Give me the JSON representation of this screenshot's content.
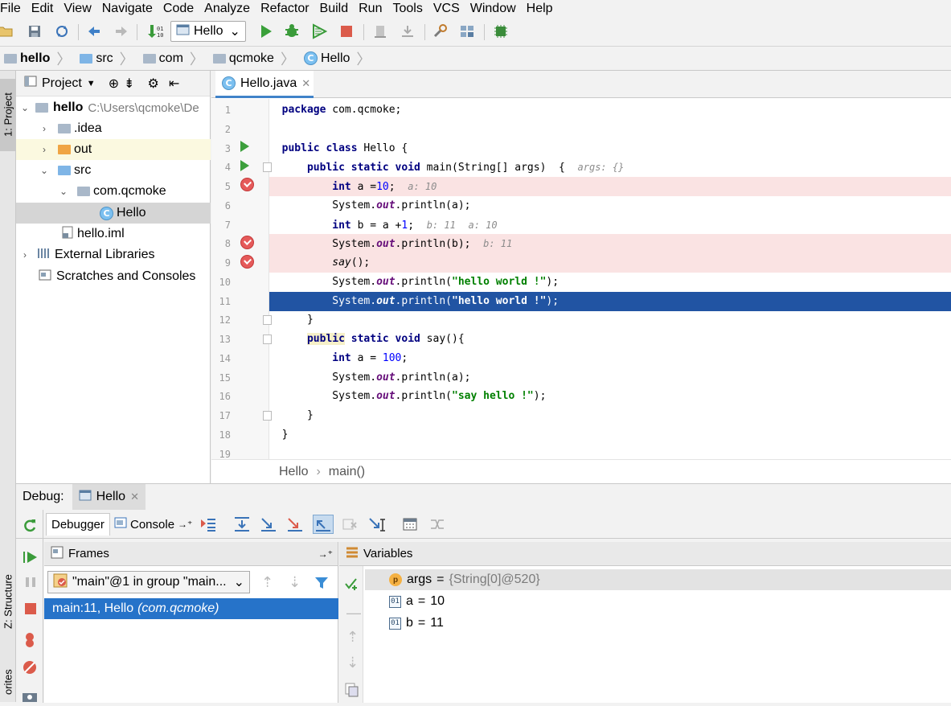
{
  "menu": [
    "File",
    "Edit",
    "View",
    "Navigate",
    "Code",
    "Analyze",
    "Refactor",
    "Build",
    "Run",
    "Tools",
    "VCS",
    "Window",
    "Help"
  ],
  "toolbar": {
    "run_config": "Hello"
  },
  "breadcrumbs": [
    "hello",
    "src",
    "com",
    "qcmoke",
    "Hello"
  ],
  "left_strip": {
    "project_tab": "1: Project",
    "structure_tab": "Z: Structure",
    "favorites_tab": "orites"
  },
  "project": {
    "header": "Project",
    "tree": [
      {
        "label": "hello",
        "path": "C:\\Users\\qcmoke\\De"
      },
      {
        "label": ".idea"
      },
      {
        "label": "out"
      },
      {
        "label": "src"
      },
      {
        "label": "com.qcmoke"
      },
      {
        "label": "Hello"
      },
      {
        "label": "hello.iml"
      },
      {
        "label": "External Libraries"
      },
      {
        "label": "Scratches and Consoles"
      }
    ]
  },
  "editor": {
    "tab": "Hello.java",
    "line_numbers": [
      "1",
      "2",
      "3",
      "4",
      "5",
      "6",
      "7",
      "8",
      "9",
      "10",
      "11",
      "12",
      "13",
      "14",
      "15",
      "16",
      "17",
      "18",
      "19"
    ],
    "hints": {
      "l4": "args: {}",
      "l5": "a: 10",
      "l7a": "b: 11",
      "l7b": "a: 10",
      "l8": "b: 11"
    },
    "breadcrumb": [
      "Hello",
      "main()"
    ]
  },
  "debug": {
    "label": "Debug:",
    "session": "Hello",
    "tabs": {
      "debugger": "Debugger",
      "console": "Console"
    },
    "frames_title": "Frames",
    "thread": "\"main\"@1 in group \"main...",
    "frame": {
      "loc": "main:11, Hello",
      "pkg": "(com.qcmoke)"
    },
    "variables_title": "Variables",
    "variables": [
      {
        "name": "args",
        "value": "{String[0]@520}"
      },
      {
        "name": "a",
        "value": "10"
      },
      {
        "name": "b",
        "value": "11"
      }
    ]
  },
  "colors": {
    "selection": "#2154a3",
    "breakpoint_line": "#fae3e3",
    "frame_selected": "#2673c9"
  }
}
